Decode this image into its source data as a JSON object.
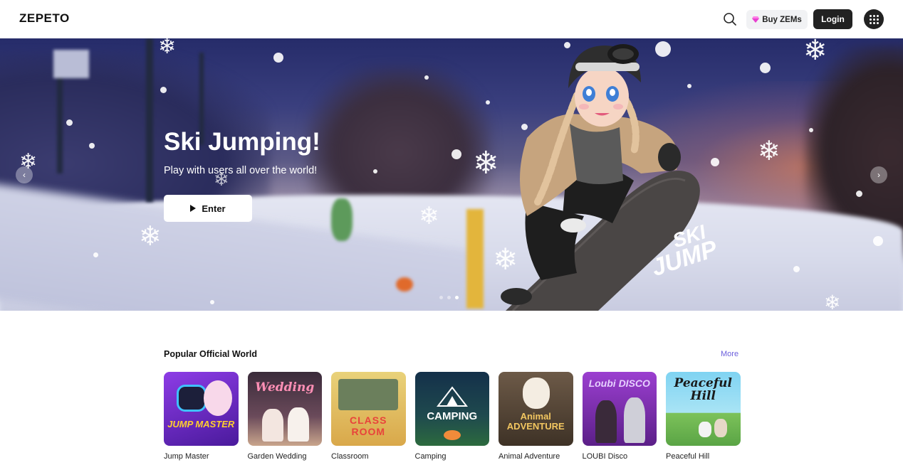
{
  "header": {
    "logo": "ZEPETO",
    "buy_zems_label": "Buy ZEMs",
    "login_label": "Login"
  },
  "hero": {
    "title": "Ski Jumping!",
    "subtitle": "Play with users all over the world!",
    "enter_label": "Enter",
    "logo_line1": "SKI",
    "logo_line2": "JUMP",
    "slides_total": 3,
    "active_slide": 3
  },
  "section": {
    "title": "Popular Official World",
    "more_label": "More",
    "worlds": [
      {
        "name": "Jump Master",
        "thumb_text": "JUMP MASTER",
        "bg": "#7a2fd0",
        "accent": "#ffcf2e"
      },
      {
        "name": "Garden Wedding",
        "thumb_text": "Wedding",
        "bg": "#3b2d3a",
        "accent": "#ff8fb5"
      },
      {
        "name": "Classroom",
        "thumb_text": "CLASS ROOM",
        "bg": "#e8c45a",
        "accent": "#e8433b"
      },
      {
        "name": "Camping",
        "thumb_text": "CAMPING",
        "bg": "#1f3f46",
        "accent": "#ffffff"
      },
      {
        "name": "Animal Adventure",
        "thumb_text": "Animal ADVENTURE",
        "bg": "#5e4a38",
        "accent": "#f2c660"
      },
      {
        "name": "LOUBI Disco",
        "thumb_text": "Loubi DISCO",
        "bg": "#8a2fb8",
        "accent": "#e6d0ff"
      },
      {
        "name": "Peaceful Hill",
        "thumb_text": "Peaceful Hill",
        "bg": "#6ec3e8",
        "accent": "#1a1a1a"
      }
    ]
  },
  "colors": {
    "accent_link": "#6b5fdc",
    "dark_button": "#222222",
    "gem": "#e83fd0"
  },
  "icons": {
    "search": "search-icon",
    "gem": "gem-icon",
    "apps": "grid-menu-icon",
    "play": "play-icon",
    "prev": "chevron-left-icon",
    "next": "chevron-right-icon"
  }
}
